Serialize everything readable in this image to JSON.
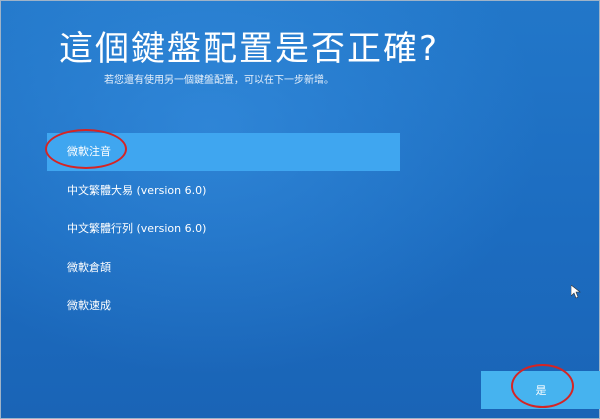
{
  "page": {
    "title": "這個鍵盤配置是否正確?",
    "subtitle": "若您還有使用另一個鍵盤配置，可以在下一步新增。"
  },
  "layouts": {
    "selected_index": 0,
    "items": [
      {
        "label": "微軟注音"
      },
      {
        "label": "中文繁體大易 (version 6.0)"
      },
      {
        "label": "中文繁體行列 (version 6.0)"
      },
      {
        "label": "微軟倉頡"
      },
      {
        "label": "微軟速成"
      }
    ]
  },
  "actions": {
    "confirm_label": "是"
  },
  "icons": {
    "cursor": "mouse-pointer-icon"
  },
  "colors": {
    "background": "#1e6fc0",
    "selected_item": "#3fa6f0",
    "button": "#46b3ef",
    "annotation_circle": "#d52424"
  }
}
